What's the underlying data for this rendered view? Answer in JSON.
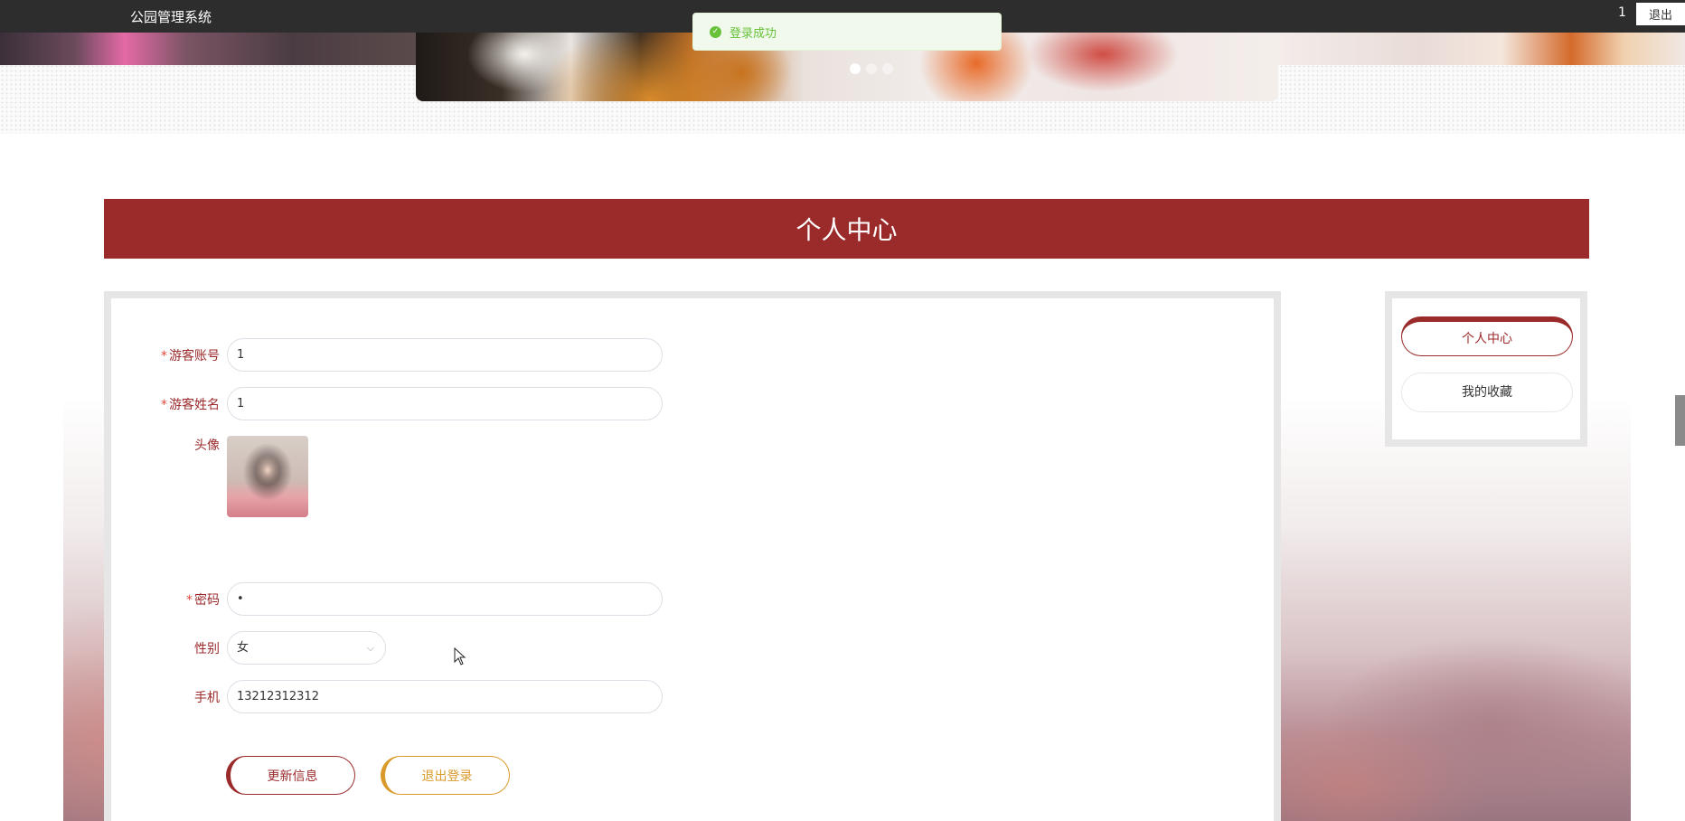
{
  "topbar": {
    "title": "公园管理系统",
    "user": "1",
    "logout_label": "退出"
  },
  "toast": {
    "message": "登录成功",
    "icon": "check-circle-icon",
    "color": "#67c23a"
  },
  "carousel": {
    "slide_count": 3,
    "active_index": 0
  },
  "page": {
    "heading": "个人中心"
  },
  "form": {
    "account": {
      "label": "游客账号",
      "required": "*",
      "value": "1"
    },
    "name": {
      "label": "游客姓名",
      "required": "*",
      "value": "1"
    },
    "avatar": {
      "label": "头像"
    },
    "password": {
      "label": "密码",
      "required": "*",
      "value": "•"
    },
    "gender": {
      "label": "性别",
      "value": "女"
    },
    "phone": {
      "label": "手机",
      "value": "13212312312"
    },
    "update_button": "更新信息",
    "logout_button": "退出登录"
  },
  "sidebar": {
    "items": [
      {
        "label": "个人中心",
        "active": true
      },
      {
        "label": "我的收藏",
        "active": false
      }
    ]
  },
  "colors": {
    "accent": "#9b2a2b",
    "secondary": "#d99a2b",
    "topbar": "#2d2d2d"
  }
}
